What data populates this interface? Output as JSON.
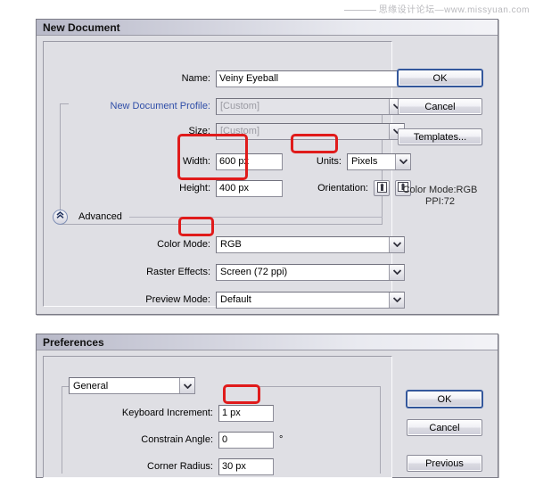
{
  "watermark": {
    "text": "思缘设计论坛—www.missyuan.com"
  },
  "new_document_dialog": {
    "title": "New Document",
    "fields": {
      "name_label": "Name:",
      "name_value": "Veiny Eyeball",
      "profile_label": "New Document Profile:",
      "profile_value": "[Custom]",
      "size_label": "Size:",
      "size_value": "[Custom]",
      "width_label": "Width:",
      "width_value": "600 px",
      "units_label": "Units:",
      "units_value": "Pixels",
      "height_label": "Height:",
      "height_value": "400 px",
      "orientation_label": "Orientation:"
    },
    "advanced": {
      "section_label": "Advanced",
      "color_mode_label": "Color Mode:",
      "color_mode_value": "RGB",
      "raster_effects_label": "Raster Effects:",
      "raster_effects_value": "Screen (72 ppi)",
      "preview_mode_label": "Preview Mode:",
      "preview_mode_value": "Default"
    },
    "buttons": {
      "ok": "OK",
      "cancel": "Cancel",
      "templates": "Templates..."
    },
    "info": {
      "color_mode": "Color Mode:RGB",
      "ppi": "PPI:72"
    },
    "icons": {
      "portrait": "portrait-orientation-icon",
      "landscape": "landscape-orientation-icon",
      "collapse": "chevron-double-up-icon"
    }
  },
  "preferences_dialog": {
    "title": "Preferences",
    "category_value": "General",
    "fields": {
      "keyboard_increment_label": "Keyboard Increment:",
      "keyboard_increment_value": "1 px",
      "constrain_angle_label": "Constrain Angle:",
      "constrain_angle_value": "0",
      "constrain_angle_unit": "°",
      "corner_radius_label": "Corner Radius:",
      "corner_radius_value": "30 px"
    },
    "buttons": {
      "ok": "OK",
      "cancel": "Cancel",
      "previous": "Previous"
    }
  },
  "highlight_color": "#e01b1b"
}
